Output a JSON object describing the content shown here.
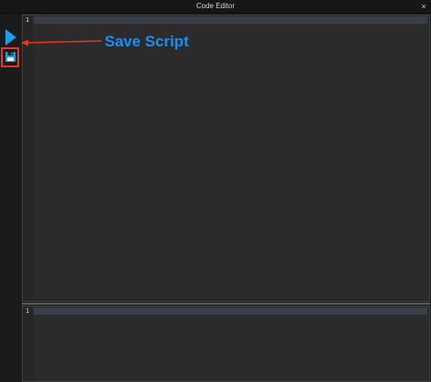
{
  "window": {
    "title": "Code Editor",
    "close_glyph": "×"
  },
  "toolbar": {
    "run_icon": "play-icon",
    "save_icon": "floppy-disk-icon",
    "accent_color": "#1f9ee8"
  },
  "editor": {
    "line_numbers": [
      "1"
    ]
  },
  "output": {
    "line_numbers": [
      "1"
    ]
  },
  "annotation": {
    "label": "Save Script",
    "label_color": "#1f8ef1",
    "marker_color": "#e8361f"
  }
}
